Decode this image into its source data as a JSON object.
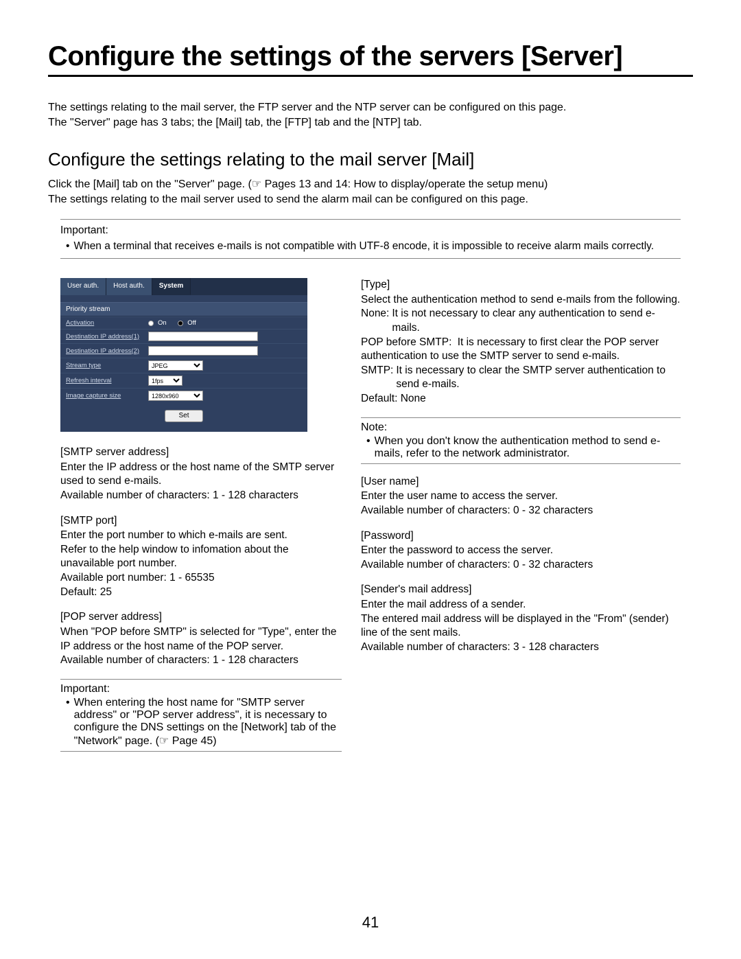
{
  "title": "Configure the settings of the servers [Server]",
  "intro1": "The settings relating to the mail server, the FTP server and the NTP server can be configured on this page.",
  "intro2": "The \"Server\" page has 3 tabs; the [Mail] tab, the [FTP] tab and the [NTP] tab.",
  "subtitle": "Configure the settings relating to the mail server [Mail]",
  "subintro1": "Click the [Mail] tab on the \"Server\" page. (☞ Pages 13 and 14: How to display/operate the setup menu)",
  "subintro2": "The settings relating to the mail server used to send the alarm mail can be configured on this page.",
  "important_label": "Important:",
  "important_text": "When a terminal that receives e-mails is not compatible with UTF-8 encode, it is impossible to receive alarm mails correctly.",
  "ss": {
    "tabs": {
      "t1": "User auth.",
      "t2": "Host auth.",
      "t3": "System"
    },
    "section": "Priority stream",
    "rows": {
      "activation": {
        "label": "Activation",
        "on": "On",
        "off": "Off"
      },
      "dest1": {
        "label": "Destination IP address(1)"
      },
      "dest2": {
        "label": "Destination IP address(2)"
      },
      "stype": {
        "label": "Stream type",
        "val": "JPEG"
      },
      "refresh": {
        "label": "Refresh interval",
        "val": "1fps"
      },
      "imgsize": {
        "label": "Image capture size",
        "val": "1280x960"
      }
    },
    "set": "Set"
  },
  "left": {
    "smtp_addr_h": "[SMTP server address]",
    "smtp_addr_b": "Enter the IP address or the host name of the SMTP server used to send e-mails.",
    "smtp_addr_c": "Available number of characters: 1 - 128 characters",
    "smtp_port_h": "[SMTP port]",
    "smtp_port_b1": "Enter the port number to which e-mails are sent.",
    "smtp_port_b2": "Refer to the help window to infomation about the unavailable port number.",
    "smtp_port_b3": "Available port number: 1 - 65535",
    "smtp_port_b4": "Default: 25",
    "pop_h": "[POP server address]",
    "pop_b1": "When \"POP before SMTP\" is selected for \"Type\", enter the IP address or the host name of the POP server.",
    "pop_b2": "Available number of characters: 1 - 128 characters",
    "imp2_label": "Important:",
    "imp2_text": "When entering the host name for \"SMTP server address\" or \"POP server address\", it is necessary to configure the DNS settings on the [Network] tab of the \"Network\" page. (☞ Page 45)"
  },
  "right": {
    "type_h": "[Type]",
    "type_b": "Select the authentication method to send e-mails from the following.",
    "type_none_n": "None:",
    "type_none_t": " It is not necessary to clear any authentication to send e-mails.",
    "type_pop_n": "POP before SMTP:",
    "type_pop_t": " It is necessary to first clear the POP server authentication to use the SMTP server to send e-mails.",
    "type_smtp_n": "SMTP:",
    "type_smtp_t": " It is necessary to clear the SMTP server authentication to send e-mails.",
    "type_def": "Default: None",
    "note_label": "Note:",
    "note_text": "When you don't know the authentication method to send e-mails, refer to the network administrator.",
    "user_h": "[User name]",
    "user_b": "Enter the user name to access the server.",
    "user_c": "Available number of characters: 0 - 32 characters",
    "pass_h": "[Password]",
    "pass_b": "Enter the password to access the server.",
    "pass_c": "Available number of characters: 0 - 32 characters",
    "sender_h": "[Sender's mail address]",
    "sender_b1": "Enter the mail address of a sender.",
    "sender_b2": "The entered mail address will be displayed in the \"From\" (sender) line of the sent mails.",
    "sender_c": "Available number of characters: 3 - 128 characters"
  },
  "page_number": "41"
}
